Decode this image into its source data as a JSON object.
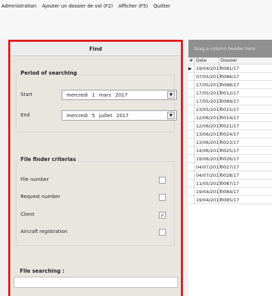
{
  "menu": [
    "Administration",
    "Ajouter un dossier de vol (F2)",
    "Afficher (F5)",
    "Quitter"
  ],
  "find_panel": {
    "title": "Find",
    "period_group": {
      "title": "Period of searching",
      "start_label": "Start",
      "start": {
        "weekday": "mercredi",
        "day": "1",
        "month": "mars",
        "year": "2017"
      },
      "end_label": "End",
      "end": {
        "weekday": "mercredi",
        "day": "5",
        "month": "juillet",
        "year": "2017"
      }
    },
    "criteria_group": {
      "title": "File finder criterias",
      "items": [
        {
          "label": "File number",
          "checked": false
        },
        {
          "label": "Request number",
          "checked": false
        },
        {
          "label": "Client",
          "checked": true
        },
        {
          "label": "Aircraft registration",
          "checked": false
        }
      ]
    },
    "search_label": "File searching :",
    "search_value": ""
  },
  "grid": {
    "group_hint": "Drag a column header here",
    "columns": [
      "Date",
      "Dossier"
    ],
    "rows": [
      {
        "date": "19/04/2017",
        "dossier": "0081/17"
      },
      {
        "date": "07/05/2017",
        "dossier": "0086/17"
      },
      {
        "date": "17/05/2017",
        "dossier": "0088/17"
      },
      {
        "date": "17/05/2017",
        "dossier": "0012/17"
      },
      {
        "date": "17/05/2017",
        "dossier": "0089/17"
      },
      {
        "date": "23/05/2017",
        "dossier": "0015/17"
      },
      {
        "date": "12/06/2017",
        "dossier": "0014/17"
      },
      {
        "date": "12/06/2017",
        "dossier": "0021/17"
      },
      {
        "date": "13/06/2017",
        "dossier": "0024/17"
      },
      {
        "date": "13/06/2017",
        "dossier": "0023/17"
      },
      {
        "date": "14/06/2017",
        "dossier": "0025/17"
      },
      {
        "date": "19/06/2017",
        "dossier": "0026/17"
      },
      {
        "date": "04/07/2017",
        "dossier": "0027/17"
      },
      {
        "date": "04/07/2017",
        "dossier": "0028/17"
      },
      {
        "date": "11/05/2017",
        "dossier": "0087/17"
      },
      {
        "date": "19/04/2017",
        "dossier": "0084/17"
      },
      {
        "date": "19/04/2017",
        "dossier": "0085/17"
      }
    ]
  }
}
